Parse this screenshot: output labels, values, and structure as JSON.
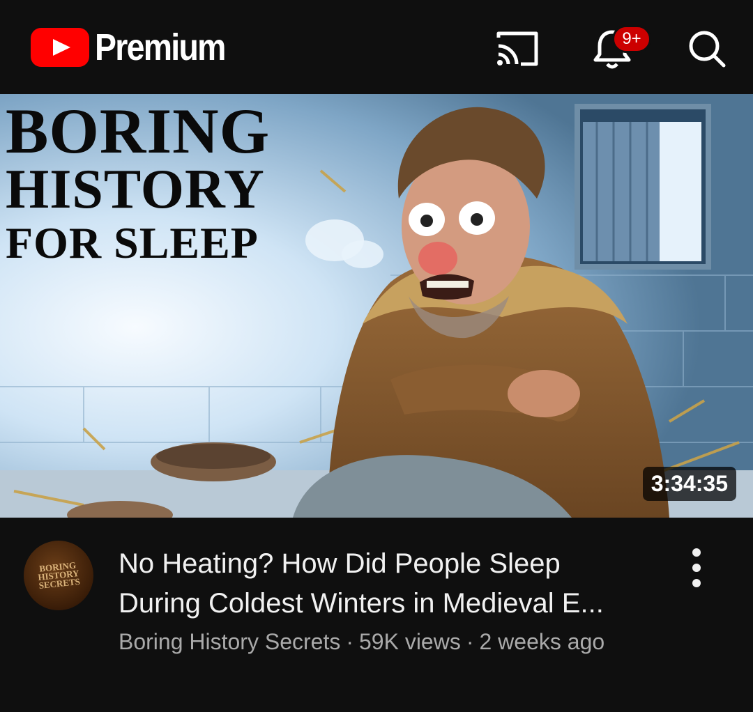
{
  "header": {
    "logo_text": "Premium",
    "notification_count": "9+",
    "icons": [
      "cast-icon",
      "bell-icon",
      "search-icon"
    ]
  },
  "video": {
    "thumbnail_text": {
      "line1": "BORING",
      "line2": "HISTORY",
      "line3": "FOR SLEEP"
    },
    "duration": "3:34:35",
    "title_line1": "No Heating? How Did People Sleep",
    "title_line2": "During Coldest Winters in Medieval E...",
    "channel": "Boring History Secrets",
    "views": "59K views",
    "age": "2 weeks ago",
    "avatar_text": "BORING HISTORY SECRETS"
  },
  "colors": {
    "brand_red": "#ff0000",
    "badge_red": "#cc0000",
    "background": "#0f0f0f",
    "secondary_text": "#aaaaaa"
  }
}
